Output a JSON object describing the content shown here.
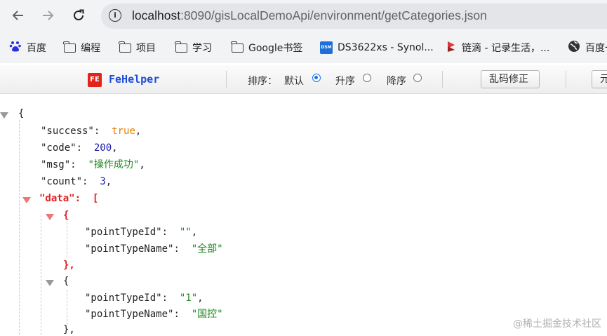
{
  "browser": {
    "url_prefix": "localhost",
    "url_rest": ":8090/gisLocalDemoApi/environment/getCategories.json",
    "info_icon": "i"
  },
  "bookmarks": [
    {
      "label": "百度",
      "icon": "baidu-icon"
    },
    {
      "label": "编程",
      "icon": "folder-icon"
    },
    {
      "label": "项目",
      "icon": "folder-icon"
    },
    {
      "label": "学习",
      "icon": "folder-icon"
    },
    {
      "label": "Google书签",
      "icon": "folder-icon"
    },
    {
      "label": "DS3622xs - Synol...",
      "icon": "dsm-icon",
      "icon_text": "DSM"
    },
    {
      "label": "链滴 - 记录生活，...",
      "icon": "ld-icon"
    },
    {
      "label": "百度一",
      "icon": "globe-icon"
    }
  ],
  "fehelper": {
    "logo": "FE",
    "title": "FeHelper",
    "sort_label": "排序：",
    "sort_options": [
      "默认",
      "升序",
      "降序"
    ],
    "sort_selected": "默认",
    "fix_button": "乱码修正",
    "next_button": "元"
  },
  "json_view": {
    "open_brace": "{",
    "success_key": "\"success\"",
    "success_val": "true",
    "code_key": "\"code\"",
    "code_val": "200",
    "msg_key": "\"msg\"",
    "msg_val": "\"操作成功\"",
    "count_key": "\"count\"",
    "count_val": "3",
    "data_key": "\"data\"",
    "data_open": "[",
    "items": [
      {
        "id_key": "\"pointTypeId\"",
        "id_val": "\"\"",
        "name_key": "\"pointTypeName\"",
        "name_val": "\"全部\""
      },
      {
        "id_key": "\"pointTypeId\"",
        "id_val": "\"1\"",
        "name_key": "\"pointTypeName\"",
        "name_val": "\"国控\""
      }
    ],
    "colon": ":",
    "comma": ",",
    "obj_open": "{",
    "obj_close": "},"
  },
  "watermark": "@稀土掘金技术社区",
  "colors": {
    "key": "#222222",
    "string": "#228822",
    "number": "#1a1aa6",
    "boolean": "#e67e00",
    "highlight": "#dd2222"
  }
}
